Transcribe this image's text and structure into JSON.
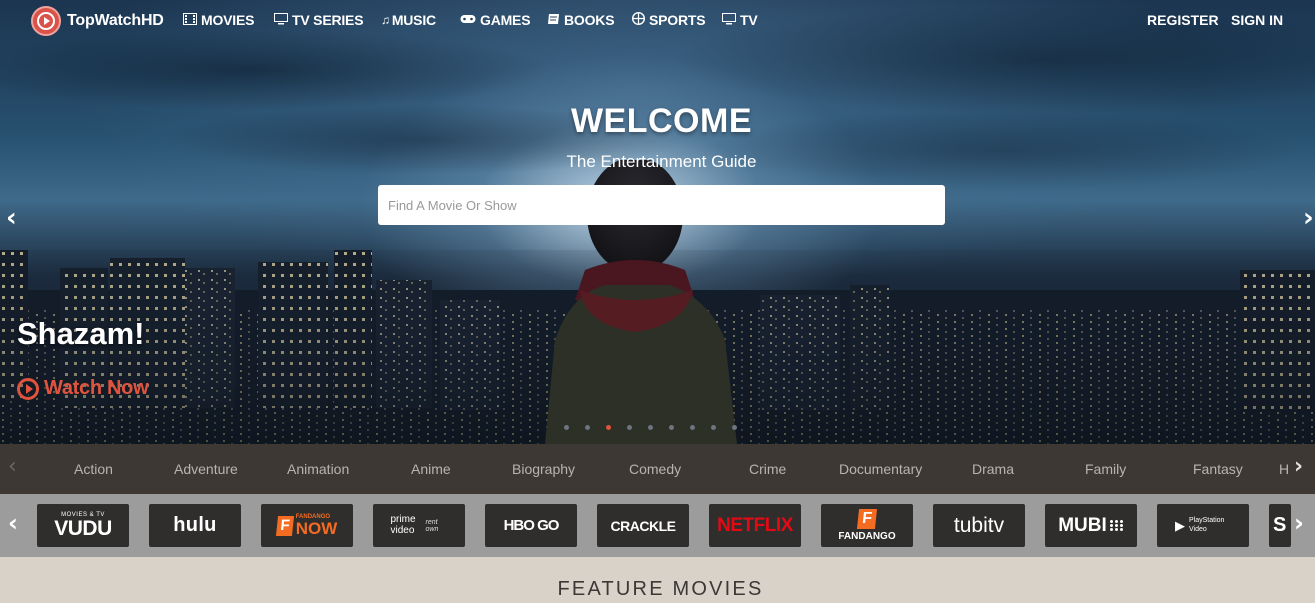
{
  "brand": {
    "name": "TopWatchHD"
  },
  "nav": {
    "items": [
      {
        "label": "MOVIES",
        "icon": "film-icon"
      },
      {
        "label": "TV SERIES",
        "icon": "monitor-icon"
      },
      {
        "label": "MUSIC",
        "icon": "music-note-icon"
      },
      {
        "label": "GAMES",
        "icon": "gamepad-icon"
      },
      {
        "label": "BOOKS",
        "icon": "book-icon"
      },
      {
        "label": "SPORTS",
        "icon": "ball-icon"
      },
      {
        "label": "TV",
        "icon": "monitor-icon"
      }
    ],
    "register": "REGISTER",
    "signin": "SIGN IN"
  },
  "hero": {
    "welcome": "WELCOME",
    "subtitle": "The Entertainment Guide",
    "search_placeholder": "Find A Movie Or Show",
    "search_value": "",
    "movie_title": "Shazam!",
    "watch_label": "Watch Now",
    "slide_count": 9,
    "active_slide": 3,
    "accent_color": "#e0533d"
  },
  "genres": [
    "Action",
    "Adventure",
    "Animation",
    "Anime",
    "Biography",
    "Comedy",
    "Crime",
    "Documentary",
    "Drama",
    "Family",
    "Fantasy",
    "H"
  ],
  "providers": [
    {
      "name": "VUDU",
      "tagline": "MOVIES & TV"
    },
    {
      "name": "hulu"
    },
    {
      "name": "NOW",
      "tagline": "FANDANGO"
    },
    {
      "name": "prime video",
      "tagline": "rent own"
    },
    {
      "name": "HBO GO"
    },
    {
      "name": "CRACKLE"
    },
    {
      "name": "NETFLIX"
    },
    {
      "name": "FANDANGO"
    },
    {
      "name": "tubitv"
    },
    {
      "name": "MUBI"
    },
    {
      "name": "PlayStation Video"
    },
    {
      "name": "S"
    }
  ],
  "feature": {
    "title": "FEATURE MOVIES"
  }
}
